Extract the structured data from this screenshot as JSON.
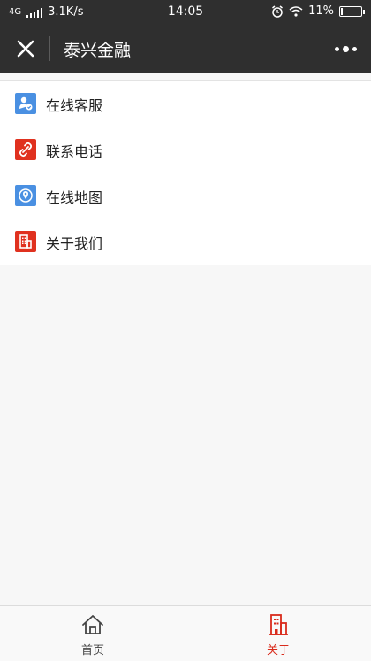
{
  "status_bar": {
    "network": "4G",
    "speed": "3.1K/s",
    "time": "14:05",
    "battery_percent": "11%",
    "battery_level": 0.11
  },
  "navbar": {
    "title": "泰兴金融",
    "close_icon": "close-icon",
    "more_icon": "more-icon"
  },
  "menu": {
    "items": [
      {
        "label": "在线客服",
        "icon": "customer-service-icon",
        "color": "#4a90e2"
      },
      {
        "label": "联系电话",
        "icon": "phone-link-icon",
        "color": "#e0311f"
      },
      {
        "label": "在线地图",
        "icon": "map-icon",
        "color": "#4a90e2"
      },
      {
        "label": "关于我们",
        "icon": "building-icon",
        "color": "#e0311f"
      }
    ]
  },
  "tabbar": {
    "tabs": [
      {
        "label": "首页",
        "icon": "home-icon",
        "active": false,
        "color": "#444444"
      },
      {
        "label": "关于",
        "icon": "building-icon",
        "active": true,
        "color": "#d92b1c"
      }
    ]
  }
}
